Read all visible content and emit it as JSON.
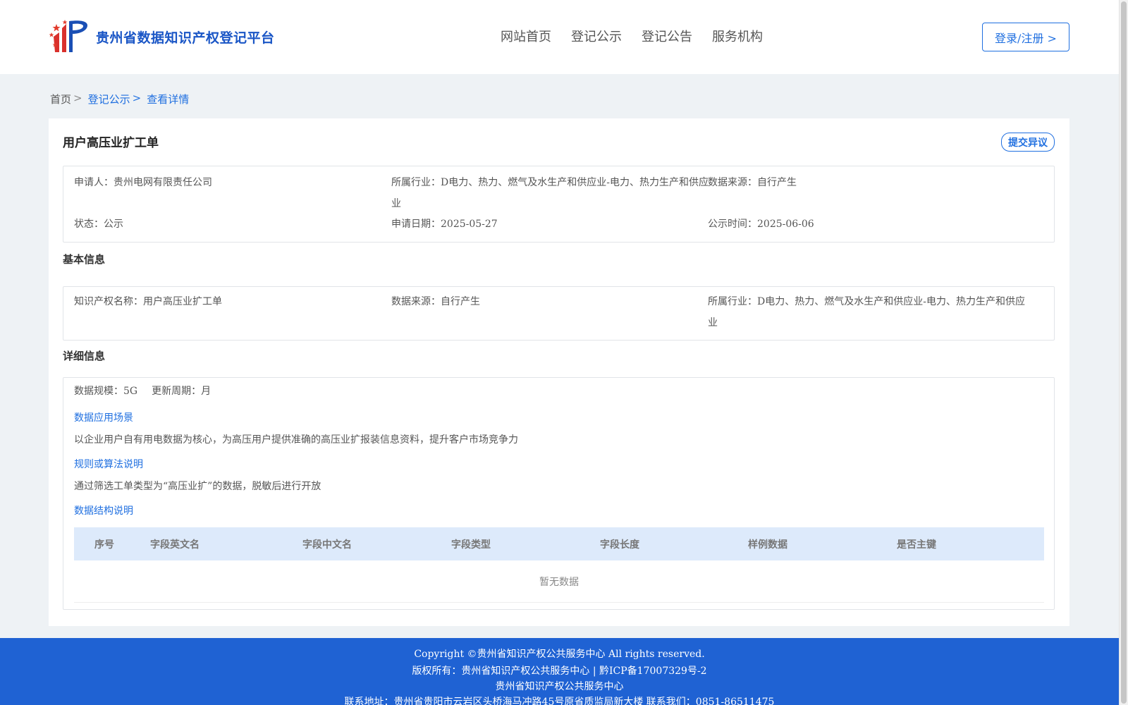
{
  "header": {
    "logo_text": "贵州省数据知识产权登记平台",
    "nav": [
      "网站首页",
      "登记公示",
      "登记公告",
      "服务机构"
    ],
    "login_label": "登录/注册 >"
  },
  "breadcrumb": {
    "home": "首页",
    "list": "登记公示",
    "current": "查看详情",
    "sep": ">"
  },
  "record": {
    "title": "用户高压业扩工单",
    "objection_label": "提交异议",
    "summary": {
      "applicant_label": "申请人：",
      "applicant": "贵州电网有限责任公司",
      "industry_label": "所属行业：",
      "industry_line1": "D电力、热力、燃气及水生产和供应业-电力、热力生产和供应",
      "industry_line2": "业",
      "source_label": "数据来源：",
      "source": "自行产生",
      "status_label": "状态：",
      "status": "公示",
      "apply_date_label": "申请日期：",
      "apply_date": "2025-05-27",
      "publish_date_label": "公示时间：",
      "publish_date": "2025-06-06"
    }
  },
  "basic": {
    "section_title": "基本信息",
    "ip_name_label": "知识产权名称：",
    "ip_name": "用户高压业扩工单",
    "source_label": "数据来源：",
    "source": "自行产生",
    "industry_label": "所属行业：",
    "industry_line1": "D电力、热力、燃气及水生产和供应业-电力、热力生产和供应",
    "industry_line2": "业"
  },
  "detail": {
    "section_title": "详细信息",
    "scale_label": "数据规模：",
    "scale": "5G",
    "period_label": "更新周期：",
    "period": "月",
    "scenario_title": "数据应用场景",
    "scenario_text": "以企业用户自有用电数据为核心，为高压用户提供准确的高压业扩报装信息资料，提升客户市场竞争力",
    "rule_title": "规则或算法说明",
    "rule_text": "通过筛选工单类型为“高压业扩”的数据，脱敏后进行开放",
    "structure_title": "数据结构说明",
    "table_headers": [
      "序号",
      "字段英文名",
      "字段中文名",
      "字段类型",
      "字段长度",
      "样例数据",
      "是否主键"
    ],
    "empty_text": "暂无数据"
  },
  "footer": {
    "line1": "Copyright ©贵州省知识产权公共服务中心 All rights reserved.",
    "line2": "版权所有：贵州省知识产权公共服务中心 | 黔ICP备17007329号-2",
    "line3": "贵州省知识产权公共服务中心",
    "line4": "联系地址：贵州省贵阳市云岩区头桥海马冲路45号原省质监局新大楼 联系我们：0851-86511475"
  }
}
